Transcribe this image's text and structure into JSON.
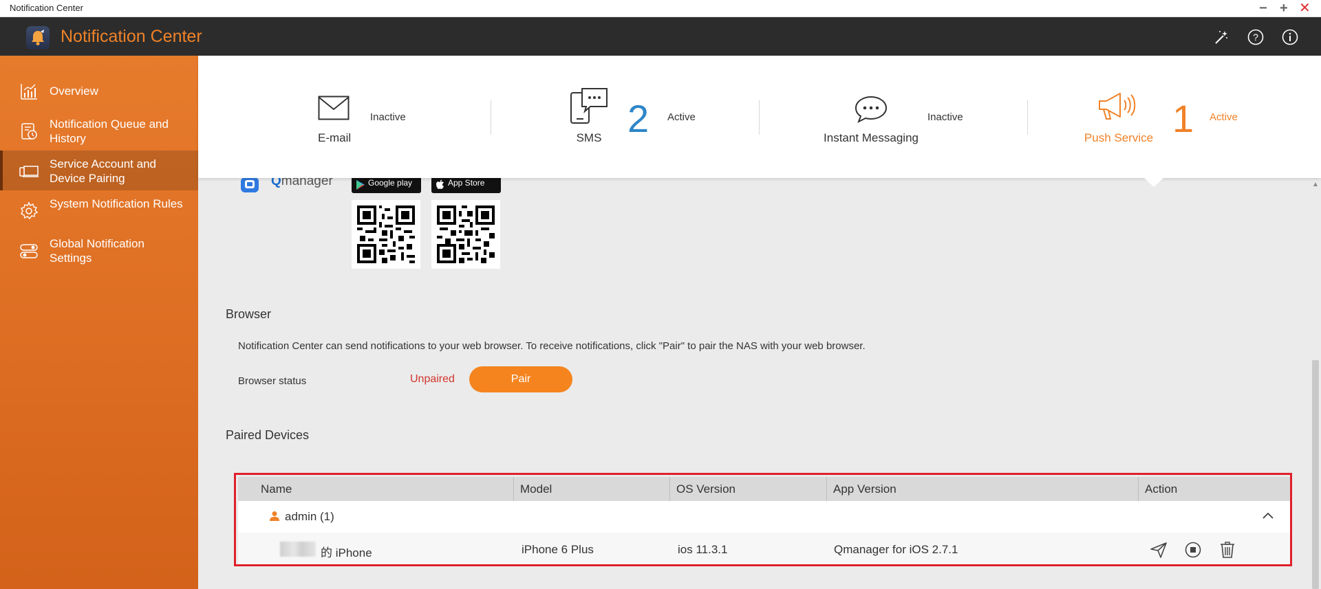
{
  "window": {
    "title": "Notification Center",
    "controls": {
      "minimize": "−",
      "maximize": "+",
      "close": "✕"
    }
  },
  "app": {
    "title": "Notification Center",
    "header_icons": [
      "magic-wand-icon",
      "help-icon",
      "info-icon"
    ]
  },
  "sidebar": {
    "items": [
      {
        "label": "Overview",
        "icon": "chart-icon",
        "active": false
      },
      {
        "label": "Notification Queue and History",
        "icon": "history-icon",
        "active": false
      },
      {
        "label": "Service Account and Device Pairing",
        "icon": "devices-icon",
        "active": true
      },
      {
        "label": "System Notification Rules",
        "icon": "gear-icon",
        "active": false
      },
      {
        "label": "Global Notification Settings",
        "icon": "toggles-icon",
        "active": false
      }
    ]
  },
  "services": [
    {
      "name": "E-mail",
      "count": "",
      "status": "Inactive",
      "icon": "email-icon"
    },
    {
      "name": "SMS",
      "count": "2",
      "status": "Active",
      "icon": "sms-icon"
    },
    {
      "name": "Instant Messaging",
      "count": "",
      "status": "Inactive",
      "icon": "chat-icon"
    },
    {
      "name": "Push Service",
      "count": "1",
      "status": "Active",
      "icon": "megaphone-icon",
      "selected": true
    }
  ],
  "qmanager": {
    "logo_text_q": "Q",
    "logo_text_rest": "manager",
    "google_play": "Google play",
    "app_store": "App Store"
  },
  "browser": {
    "title": "Browser",
    "description": "Notification Center can send notifications to your web browser. To receive notifications, click \"Pair\" to pair the NAS with your web browser.",
    "status_label": "Browser status",
    "status_value": "Unpaired",
    "pair_button": "Pair"
  },
  "paired_devices": {
    "title": "Paired Devices",
    "columns": [
      "Name",
      "Model",
      "OS Version",
      "App Version",
      "Action"
    ],
    "group": {
      "label": "admin (1)"
    },
    "devices": [
      {
        "name_suffix": "的 iPhone",
        "model": "iPhone 6 Plus",
        "os_version": "ios 11.3.1",
        "app_version": "Qmanager for iOS 2.7.1",
        "actions": [
          "send-icon",
          "stop-icon",
          "trash-icon"
        ]
      }
    ]
  },
  "colors": {
    "accent": "#f08228",
    "sidebar_top": "#e77b2c",
    "sidebar_bottom": "#d4621a",
    "header_bg": "#2c2c2c",
    "active_count": "#2e86c8",
    "unpaired": "#d0342c",
    "highlight": "#e0202a"
  }
}
